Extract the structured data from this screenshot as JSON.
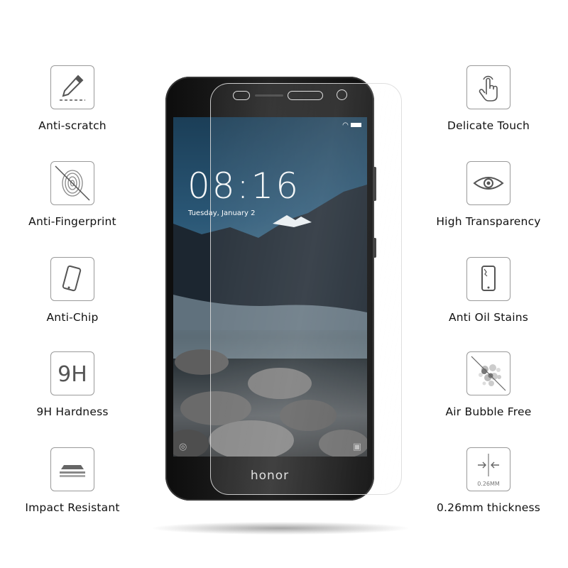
{
  "features_left": [
    {
      "label": "Anti-scratch",
      "icon": "scalpel-icon"
    },
    {
      "label": "Anti-Fingerprint",
      "icon": "fingerprint-crossed-icon"
    },
    {
      "label": "Anti-Chip",
      "icon": "phone-tilted-icon"
    },
    {
      "label": "9H Hardness",
      "icon": "9h-icon",
      "icon_text": "9H"
    },
    {
      "label": "Impact Resistant",
      "icon": "impact-layers-icon"
    }
  ],
  "features_right": [
    {
      "label": "Delicate Touch",
      "icon": "touch-hand-icon"
    },
    {
      "label": "High Transparency",
      "icon": "eye-icon"
    },
    {
      "label": "Anti Oil Stains",
      "icon": "phone-stain-icon"
    },
    {
      "label": "Air Bubble Free",
      "icon": "bubbles-crossed-icon"
    },
    {
      "label": "0.26mm thickness",
      "icon": "thickness-arrows-icon",
      "icon_text": "0.26MM"
    }
  ],
  "phone": {
    "brand": "honor",
    "clock": "08:16",
    "date": "Tuesday, January 2"
  }
}
